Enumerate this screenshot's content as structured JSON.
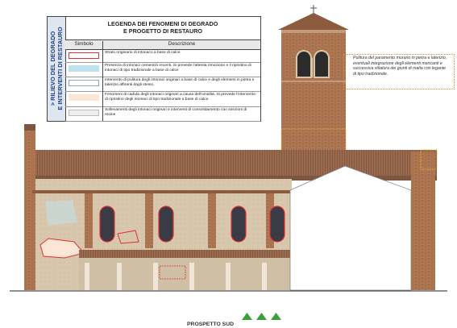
{
  "legend": {
    "side_label_line1": "> RILIEVO DEL DEGRADO",
    "side_label_line2": "E INTERVENTI DI RESTAURO",
    "title_line1": "LEGENDA DEI FENOMENI DI DEGRADO",
    "title_line2": "E  PROGETTO DI RESTAURO",
    "col_symbol": "Simbolo",
    "col_description": "Descrizione",
    "rows": [
      {
        "text": "Strato originario di intonaco a base di calce",
        "swatch": "#ffffff",
        "border": "#e03030"
      },
      {
        "text": "Presenza di intonaci cementizi recenti. Si prevede l'attenta rimozione e il ripristino di intonaci di tipo tradizionale a base di calce",
        "swatch": "#bfe1ef",
        "border": "#bfe1ef"
      },
      {
        "text": "Intervento di pulitura degli intonaci originari a base di calce e degli elementi in pietra e laterizio affiranti dagli stessi.",
        "swatch": "#ffffff",
        "border": "#8aa6c4"
      },
      {
        "text": "Fenomeni di caduta degli intonaci originari a causa dell'umidità. Si prevede l'intervento di ripristino degli intonaci di tipo tradizionale a base di calce.",
        "swatch": "#fbe6d6",
        "border": "#fbe6d6"
      },
      {
        "text": "Sollevamenti degli intonaci originari e interventi di consolidamento con iniezioni di resine",
        "swatch": "#eeeeee",
        "border": "#bbbbbb"
      }
    ]
  },
  "annotation": "Pulitura del paramento murario in pietra e laterizio, eventuali integrazione degli elementi mancanti e successiva stilatura dei giunti di malta con legante di tipo tradizionale.",
  "caption": "PROSPETTO SUD",
  "colors": {
    "accent_blue": "#1d3f87",
    "degrade_red": "#e03030",
    "brick": "#a8633e",
    "roof": "#8c5a3c",
    "arrow_green": "#3aa03a"
  }
}
